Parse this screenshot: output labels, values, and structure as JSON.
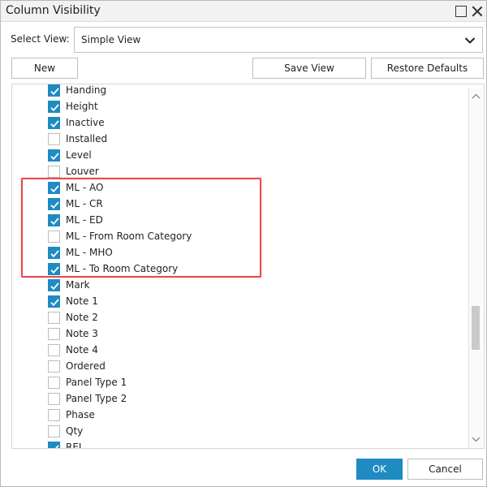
{
  "window": {
    "title": "Column Visibility"
  },
  "view_selector": {
    "label": "Select View:",
    "value": "Simple View"
  },
  "toolbar": {
    "new_label": "New",
    "save_view_label": "Save View",
    "restore_defaults_label": "Restore Defaults"
  },
  "columns": [
    {
      "label": "Handing",
      "checked": true
    },
    {
      "label": "Height",
      "checked": true
    },
    {
      "label": "Inactive",
      "checked": true
    },
    {
      "label": "Installed",
      "checked": false
    },
    {
      "label": "Level",
      "checked": true
    },
    {
      "label": "Louver",
      "checked": false
    },
    {
      "label": "ML - AO",
      "checked": true
    },
    {
      "label": "ML - CR",
      "checked": true
    },
    {
      "label": "ML - ED",
      "checked": true
    },
    {
      "label": "ML - From Room Category",
      "checked": false
    },
    {
      "label": "ML - MHO",
      "checked": true
    },
    {
      "label": "ML - To Room Category",
      "checked": true
    },
    {
      "label": "Mark",
      "checked": true
    },
    {
      "label": "Note 1",
      "checked": true
    },
    {
      "label": "Note 2",
      "checked": false
    },
    {
      "label": "Note 3",
      "checked": false
    },
    {
      "label": "Note 4",
      "checked": false
    },
    {
      "label": "Ordered",
      "checked": false
    },
    {
      "label": "Panel Type 1",
      "checked": false
    },
    {
      "label": "Panel Type 2",
      "checked": false
    },
    {
      "label": "Phase",
      "checked": false
    },
    {
      "label": "Qty",
      "checked": false
    },
    {
      "label": "REL",
      "checked": true
    }
  ],
  "footer": {
    "ok_label": "OK",
    "cancel_label": "Cancel"
  },
  "colors": {
    "accent": "#1e8bc3",
    "highlight": "#e84a4f"
  }
}
